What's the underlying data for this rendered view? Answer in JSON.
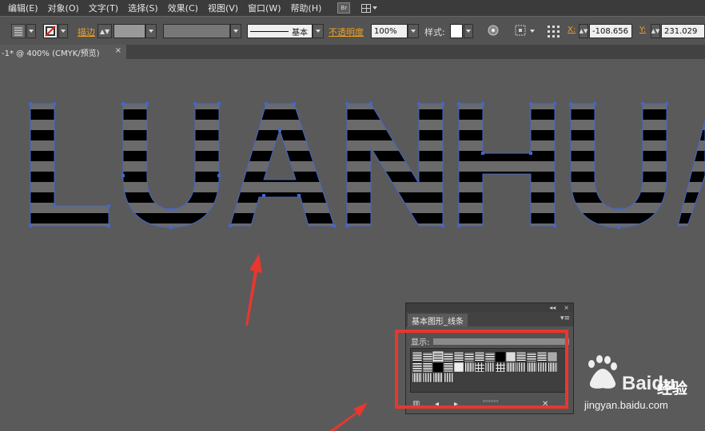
{
  "menubar": {
    "items": [
      "编辑(E)",
      "对象(O)",
      "文字(T)",
      "选择(S)",
      "效果(C)",
      "视图(V)",
      "窗口(W)",
      "帮助(H)"
    ],
    "bridge_icon": "Br"
  },
  "controlbar": {
    "stroke_label": "描边",
    "stroke_profile_value": "基本",
    "opacity_label": "不透明度",
    "opacity_value": "100%",
    "style_label": "样式:",
    "x_label": "X:",
    "x_value": "-108.656",
    "y_label": "Y:",
    "y_value": "231.029"
  },
  "document_tab": {
    "title": "-1* @ 400% (CMYK/预览)",
    "close": "×"
  },
  "canvas": {
    "artwork_text": "LUANHUA",
    "accent_color": "#4466cc",
    "arrow_color": "#e8372f"
  },
  "panel": {
    "collapse_icon": "◂◂",
    "close_icon": "×",
    "tab_title": "基本图形_线条",
    "show_label": "显示:",
    "menu_icon": "▾≡"
  },
  "watermark": {
    "brand": "Baidu",
    "subtitle": "经验",
    "url": "jingyan.baidu.com"
  }
}
